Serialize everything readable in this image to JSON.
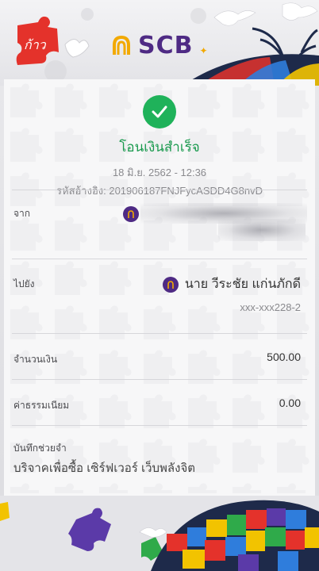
{
  "header": {
    "brand_name": "SCB",
    "campaign_logo_text": "ก้าว"
  },
  "receipt": {
    "status_title": "โอนเงินสำเร็จ",
    "datetime": "18 มิ.ย. 2562 - 12:36",
    "reference": "รหัสอ้างอิง: 201906187FNJFycASDD4G8nvD",
    "from": {
      "label": "จาก",
      "value_hidden": true
    },
    "to": {
      "label": "ไปยัง",
      "name": "นาย วีระชัย แก่นภักดี",
      "account": "xxx-xxx228-2"
    },
    "amount": {
      "label": "จำนวนเงิน",
      "value": "500.00"
    },
    "fee": {
      "label": "ค่าธรรมเนียม",
      "value": "0.00"
    },
    "memo": {
      "label": "บันทึกช่วยจำ",
      "value": "บริจาคเพื่อซื้อ เซิร์ฟเวอร์ เว็บพลังจิต"
    }
  },
  "colors": {
    "brand_purple": "#4e2a84",
    "brand_gold": "#f2a900",
    "success_green": "#1fb25a",
    "campaign_red": "#e4322b"
  },
  "icons": [
    "check-icon",
    "scb-bank-icon",
    "puzzle-piece-icon",
    "dove-icon"
  ]
}
